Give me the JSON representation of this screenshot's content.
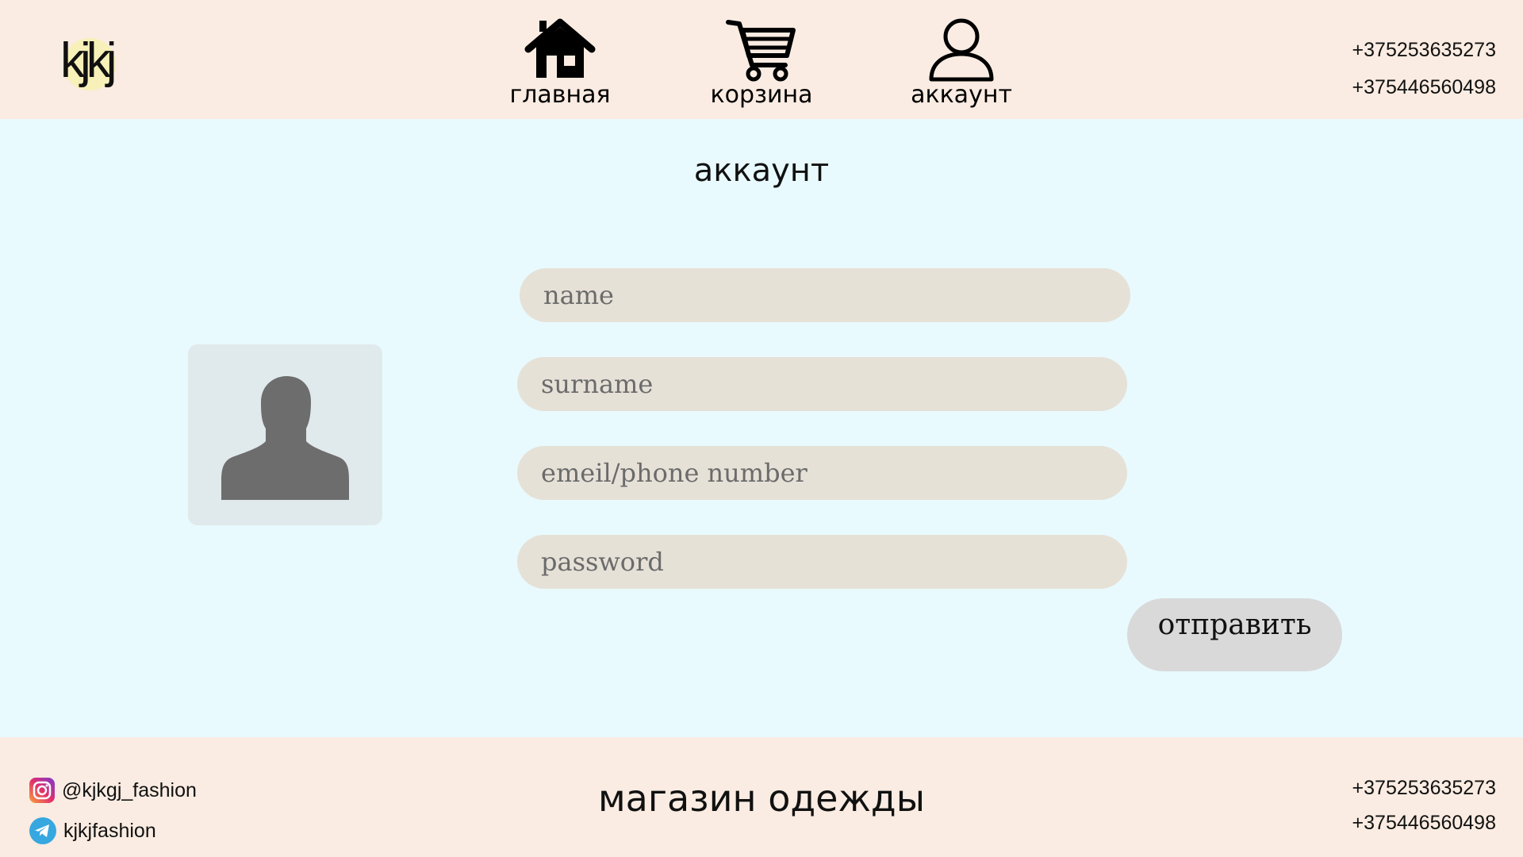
{
  "header": {
    "logo_text": "kjkj",
    "nav": [
      {
        "label": "главная",
        "icon": "home-icon"
      },
      {
        "label": "корзина",
        "icon": "cart-icon"
      },
      {
        "label": "аккаунт",
        "icon": "user-icon"
      }
    ],
    "phones": [
      "+375253635273",
      "+375446560498"
    ]
  },
  "main": {
    "title": "аккаунт",
    "avatar_icon": "user-silhouette-icon",
    "form": {
      "name_placeholder": "name",
      "surname_placeholder": "surname",
      "contact_placeholder": "emeil/phone number",
      "password_placeholder": "password",
      "submit_label": "отправить"
    }
  },
  "footer": {
    "instagram": "@kjkgj_fashion",
    "telegram": "kjkjfashion",
    "title": "магазин одежды",
    "phones": [
      "+375253635273",
      "+375446560498"
    ]
  },
  "colors": {
    "header_bg": "#faece2",
    "page_bg": "#e8fafe",
    "field_bg": "#e6e1d7",
    "button_bg": "#d9d9d9"
  }
}
